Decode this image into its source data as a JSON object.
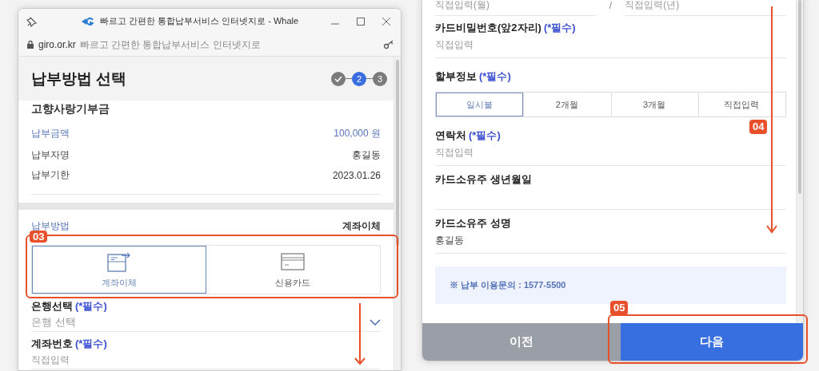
{
  "left_window": {
    "title": "빠르고 간편한 통합납부서비스 인터넷지로 - Whale",
    "url_host": "giro.or.kr",
    "url_title": "빠르고 간편한 통합납부서비스 인터넷지로",
    "page_title": "납부방법 선택",
    "steps": [
      {
        "kind": "done"
      },
      {
        "kind": "current",
        "label": "2"
      },
      {
        "kind": "pending",
        "label": "3"
      }
    ],
    "item_name": "고향사랑기부금",
    "details": [
      {
        "label": "납부금액",
        "value": "100,000 원",
        "highlight": true
      },
      {
        "label": "납부자명",
        "value": "홍길동",
        "highlight": false
      },
      {
        "label": "납부기한",
        "value": "2023.01.26",
        "highlight": false
      }
    ],
    "method": {
      "label": "납부방법",
      "value": "계좌이체"
    },
    "method_options": [
      {
        "label": "계좌이체",
        "kind": "transfer",
        "selected": true
      },
      {
        "label": "신용카드",
        "kind": "card",
        "selected": false
      }
    ],
    "fields": [
      {
        "kind": "select",
        "label": "은행선택",
        "required": "(*필수)",
        "placeholder": "은행 선택"
      },
      {
        "kind": "text",
        "label": "계좌번호",
        "required": "(*필수)",
        "placeholder": "직접입력"
      }
    ]
  },
  "right_panel": {
    "expiry": {
      "month_placeholder": "직접입력(월)",
      "separator": "/",
      "year_placeholder": "직접입력(년)"
    },
    "fields": [
      {
        "kind": "text",
        "label": "카드비밀번호(앞2자리)",
        "required": "(*필수)",
        "placeholder": "직접입력"
      },
      {
        "kind": "segments",
        "label": "할부정보",
        "required": "(*필수)",
        "options": [
          {
            "label": "일시불",
            "selected": true
          },
          {
            "label": "2개월",
            "selected": false
          },
          {
            "label": "3개월",
            "selected": false
          },
          {
            "label": "직접입력",
            "selected": false
          }
        ]
      },
      {
        "kind": "text",
        "label": "연락처",
        "required": "(*필수)",
        "placeholder": "직접입력"
      },
      {
        "kind": "text",
        "label": "카드소유주 생년월일"
      },
      {
        "kind": "text",
        "label": "카드소유주 성명",
        "value": "홍길동"
      }
    ],
    "notice": "※ 납부 이용문의 : 1577-5500",
    "buttons": [
      {
        "label": "이전",
        "kind": "secondary"
      },
      {
        "label": "다음",
        "kind": "primary"
      }
    ]
  },
  "annotations": [
    {
      "label": "03"
    },
    {
      "label": "04"
    },
    {
      "label": "05"
    }
  ]
}
